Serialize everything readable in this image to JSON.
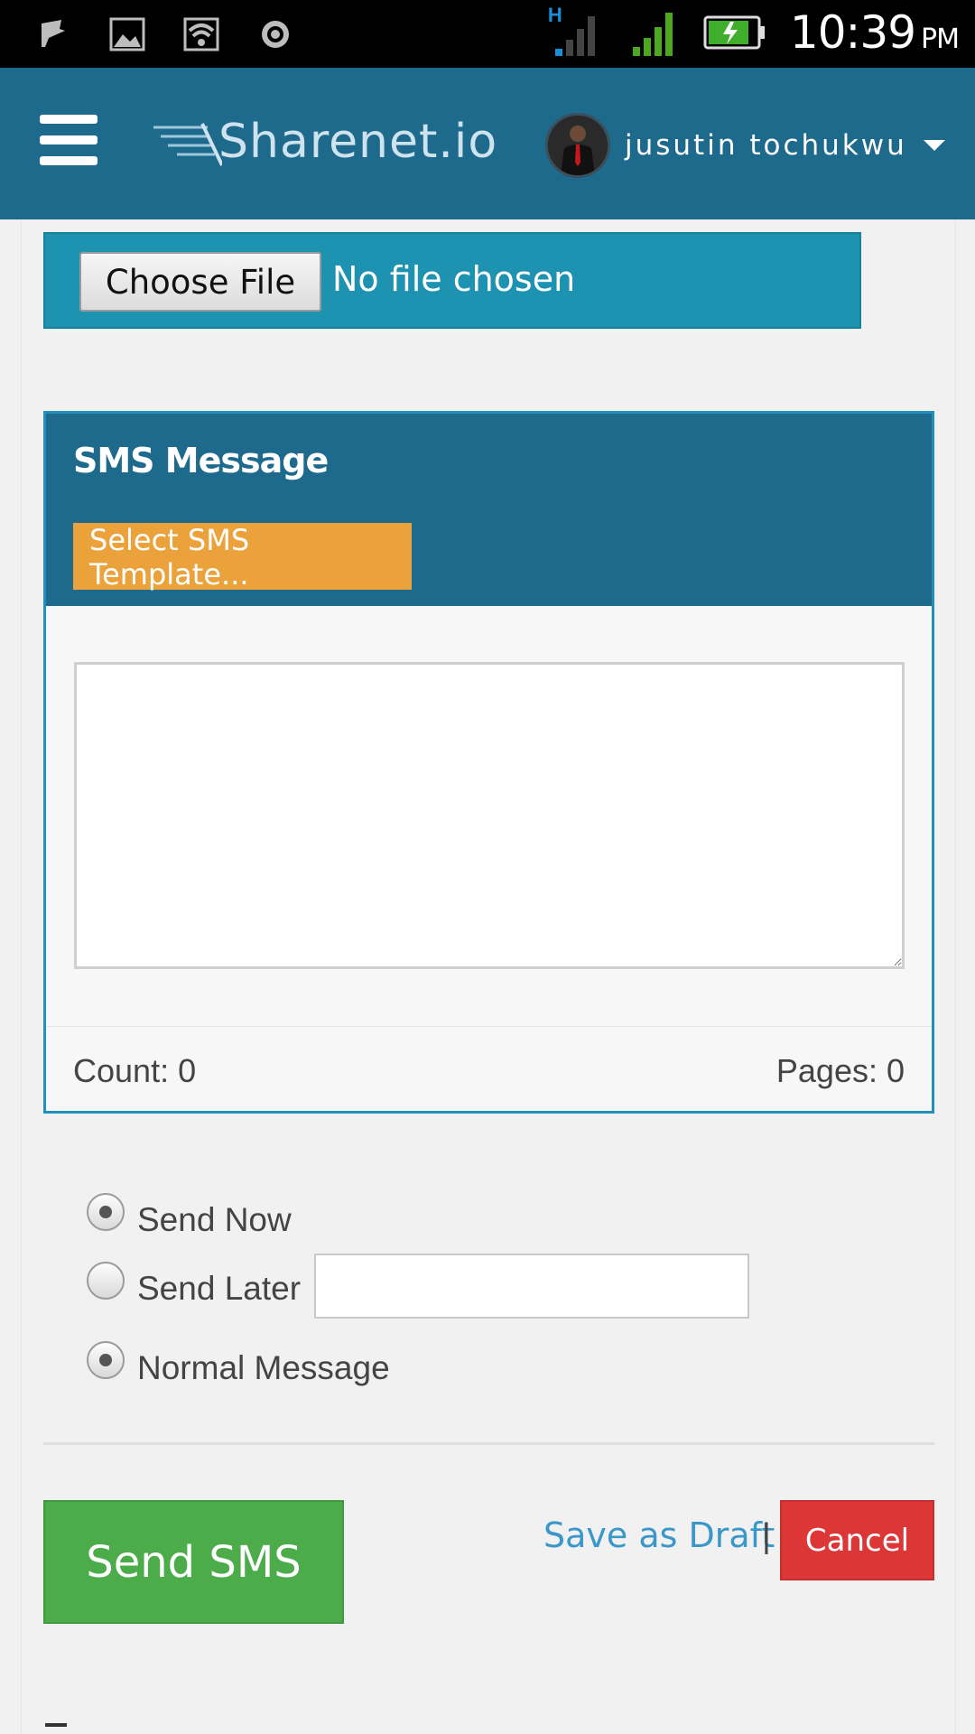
{
  "status_bar": {
    "network_type": "H",
    "time": "10:39",
    "ampm": "PM",
    "icons": [
      "flag-icon",
      "image-icon",
      "wifi-icon",
      "target-icon",
      "signal-icon",
      "signal-icon",
      "battery-charging-icon"
    ]
  },
  "header": {
    "logo_text": "Sharenet.io",
    "user_name": "jusutin tochukwu"
  },
  "upload": {
    "button_label": "Choose File",
    "status": "No file chosen"
  },
  "sms_panel": {
    "title": "SMS Message",
    "template_button": "Select SMS Template...",
    "message_value": "",
    "count_label": "Count: 0",
    "pages_label": "Pages: 0"
  },
  "options": {
    "send_now": "Send Now",
    "send_later": "Send Later",
    "send_later_value": "",
    "normal_message": "Normal Message"
  },
  "actions": {
    "send": "Send SMS",
    "draft": "Save as Draft",
    "separator": "|",
    "cancel": "Cancel"
  },
  "colors": {
    "header": "#1d6a8d",
    "file_box": "#1e92b1",
    "template_button": "#eba23a",
    "send_button": "#4cac4a",
    "cancel_button": "#dc3636",
    "link": "#3a97c9"
  }
}
